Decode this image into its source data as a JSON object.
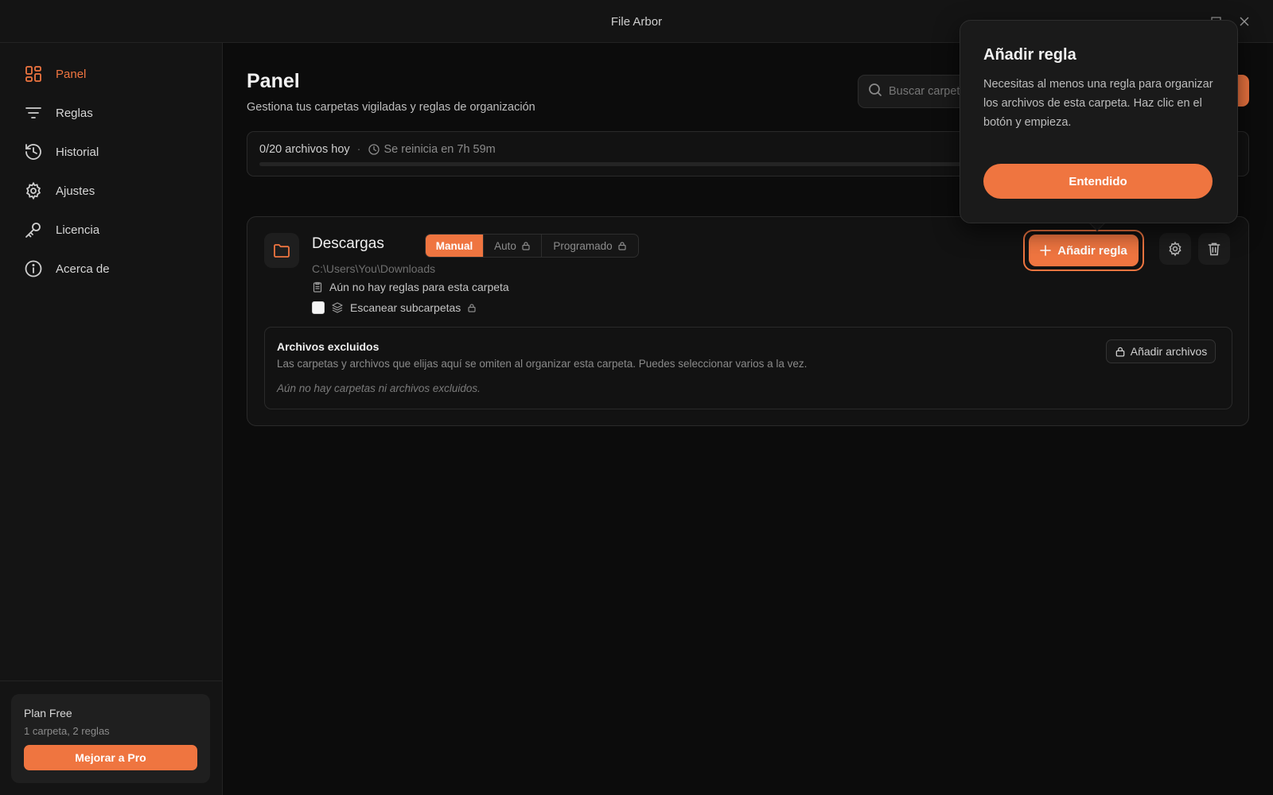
{
  "window": {
    "title": "File Arbor"
  },
  "sidebar": {
    "items": [
      {
        "label": "Panel",
        "icon": "dashboard-icon",
        "active": true
      },
      {
        "label": "Reglas",
        "icon": "filter-icon"
      },
      {
        "label": "Historial",
        "icon": "history-icon"
      },
      {
        "label": "Ajustes",
        "icon": "gear-icon"
      },
      {
        "label": "Licencia",
        "icon": "key-icon"
      },
      {
        "label": "Acerca de",
        "icon": "info-icon"
      }
    ],
    "plan": {
      "name": "Plan Free",
      "limits": "1 carpeta, 2 reglas",
      "upgrade_label": "Mejorar a Pro"
    }
  },
  "header": {
    "title": "Panel",
    "subtitle": "Gestiona tus carpetas vigiladas y reglas de organización",
    "search_placeholder": "Buscar carpetas"
  },
  "usage": {
    "count_text": "0/20 archivos hoy",
    "separator": "·",
    "reset_text": "Se reinicia en 7h 59m",
    "progress": 0
  },
  "folder": {
    "name": "Descargas",
    "path": "C:\\Users\\You\\Downloads",
    "modes": [
      "Manual",
      "Auto",
      "Programado"
    ],
    "active_mode": "Manual",
    "rules_text": "Aún no hay reglas para esta carpeta",
    "scan_label": "Escanear subcarpetas",
    "scan_checked": false,
    "add_rule_label": "Añadir regla",
    "excluded": {
      "title": "Archivos excluidos",
      "description": "Las carpetas y archivos que elijas aquí se omiten al organizar esta carpeta. Puedes seleccionar varios a la vez.",
      "empty_text": "Aún no hay carpetas ni archivos excluidos.",
      "add_label": "Añadir archivos"
    }
  },
  "popover": {
    "title": "Añadir regla",
    "body": "Necesitas al menos una regla para organizar los archivos de esta carpeta. Haz clic en el botón y empieza.",
    "button": "Entendido"
  },
  "colors": {
    "accent": "#ef7540",
    "background": "#0c0c0c",
    "surface": "#141414"
  }
}
